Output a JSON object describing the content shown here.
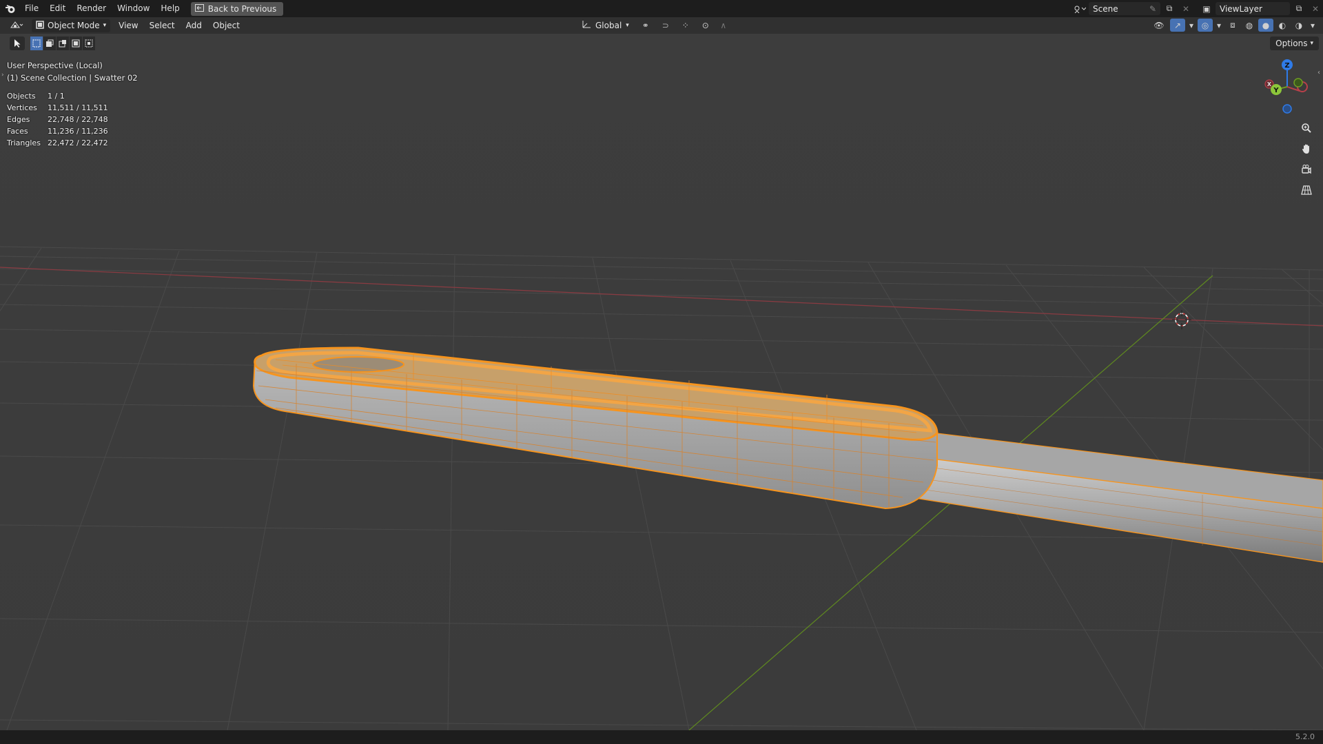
{
  "topbar": {
    "menus": [
      "File",
      "Edit",
      "Render",
      "Window",
      "Help"
    ],
    "back_label": "Back to Previous",
    "scene_name": "Scene",
    "view_layer": "ViewLayer"
  },
  "header": {
    "mode": "Object Mode",
    "menus": [
      "View",
      "Select",
      "Add",
      "Object"
    ],
    "transform_orientation": "Global"
  },
  "toolrow": {
    "options_label": "Options"
  },
  "overlay": {
    "perspective": "User Perspective (Local)",
    "collection": "(1) Scene Collection | Swatter  02"
  },
  "stats": [
    {
      "label": "Objects",
      "value": "1 / 1"
    },
    {
      "label": "Vertices",
      "value": "11,511 / 11,511"
    },
    {
      "label": "Edges",
      "value": "22,748 / 22,748"
    },
    {
      "label": "Faces",
      "value": "11,236 / 11,236"
    },
    {
      "label": "Triangles",
      "value": "22,472 / 22,472"
    }
  ],
  "gizmo": {
    "z_label": "Z",
    "y_label": "Y",
    "x_label": "X"
  },
  "statusbar": {
    "version": "5.2.0"
  },
  "colors": {
    "selection_orange": "#f7941d",
    "x_axis_red": "#b8404a",
    "y_axis_green": "#6f9c22",
    "z_axis_blue": "#2f7be8",
    "active_blue": "#4772b3"
  }
}
